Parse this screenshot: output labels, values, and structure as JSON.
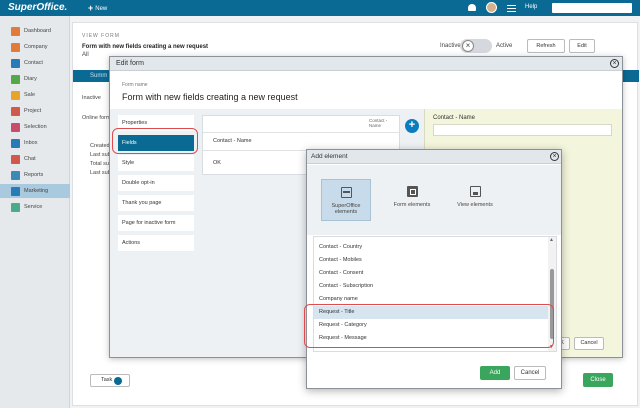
{
  "topbar": {
    "app_name": "SuperOffice.",
    "new_label": "New",
    "help_label": "Help"
  },
  "sidebar": {
    "items": [
      {
        "label": "Dashboard",
        "color": "#e07b39"
      },
      {
        "label": "Company",
        "color": "#e07b39"
      },
      {
        "label": "Contact",
        "color": "#2a7ab8"
      },
      {
        "label": "Diary",
        "color": "#55a84a"
      },
      {
        "label": "Sale",
        "color": "#e6a42a"
      },
      {
        "label": "Project",
        "color": "#d1584c"
      },
      {
        "label": "Selection",
        "color": "#c94c6a"
      },
      {
        "label": "Inbox",
        "color": "#2a7ab8"
      },
      {
        "label": "Chat",
        "color": "#d1584c"
      },
      {
        "label": "Reports",
        "color": "#3a8ab5"
      },
      {
        "label": "Marketing",
        "color": "#2a7ab8",
        "active": true
      },
      {
        "label": "Service",
        "color": "#4aaa8a"
      }
    ]
  },
  "background": {
    "record_type": "VIEW FORM",
    "title": "Form with new fields creating a new request",
    "subtitle": "All",
    "inactive_label": "Inactive",
    "active_label": "Active",
    "refresh_label": "Refresh",
    "edit_label": "Edit",
    "tab_label": "Summ",
    "status_text": "Inactive",
    "online_label": "Online form",
    "created_label": "Created",
    "last_sub_1": "Last sub",
    "total_sub": "Total sub",
    "last_sub_2": "Last sub",
    "task_label": "Task",
    "close_label": "Close"
  },
  "edit_form": {
    "title": "Edit form",
    "form_name_label": "Form name",
    "form_name_value": "Form with new fields creating a new request",
    "menu": [
      "Properties",
      "Fields",
      "Style",
      "Double opt-in",
      "Thank you page",
      "Page for inactive form",
      "Actions"
    ],
    "selected_menu": "Fields",
    "fields_counter": "Contact - Name",
    "field_row_1": "Contact - Name",
    "field_row_2": "OK",
    "preview_label": "Contact - Name",
    "ok_label": "OK",
    "cancel_label": "Cancel"
  },
  "add_element": {
    "title": "Add element",
    "sources": [
      {
        "label": "SuperOffice elements",
        "icon": "superoffice-elements-icon",
        "selected": true
      },
      {
        "label": "Form elements",
        "icon": "form-elements-icon"
      },
      {
        "label": "View elements",
        "icon": "view-elements-icon"
      }
    ],
    "elements": [
      "Contact - Country",
      "Contact - Mobiles",
      "Contact - Consent",
      "Contact - Subscription",
      "Company name",
      "Request - Title",
      "Request - Category",
      "Request - Message"
    ],
    "selected_element": "Request - Title",
    "add_label": "Add",
    "cancel_label": "Cancel"
  }
}
